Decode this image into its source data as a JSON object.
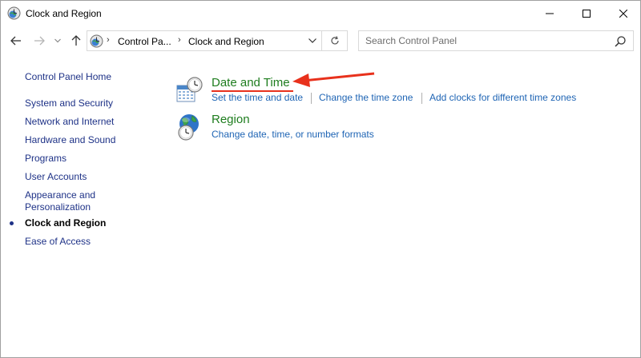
{
  "window": {
    "title": "Clock and Region",
    "title_icon": "clock-globe-icon"
  },
  "controls": {
    "minimize": "minimize-icon",
    "maximize": "maximize-icon",
    "close": "close-icon"
  },
  "nav": {
    "back": "arrow-left-icon",
    "forward": "arrow-right-icon",
    "recent": "chevron-down-icon",
    "up": "arrow-up-icon"
  },
  "address": {
    "breadcrumbs": [
      "Control Pa...",
      "Clock and Region"
    ],
    "separator": "›"
  },
  "search": {
    "placeholder": "Search Control Panel",
    "value": ""
  },
  "sidebar": {
    "home": "Control Panel Home",
    "items": [
      {
        "label": "System and Security",
        "current": false
      },
      {
        "label": "Network and Internet",
        "current": false
      },
      {
        "label": "Hardware and Sound",
        "current": false
      },
      {
        "label": "Programs",
        "current": false
      },
      {
        "label": "User Accounts",
        "current": false
      },
      {
        "label": "Appearance and",
        "label2": "Personalization",
        "current": false
      },
      {
        "label": "Clock and Region",
        "current": true
      },
      {
        "label": "Ease of Access",
        "current": false
      }
    ]
  },
  "categories": [
    {
      "title": "Date and Time",
      "icon": "calendar-clock-icon",
      "tasks": [
        "Set the time and date",
        "Change the time zone",
        "Add clocks for different time zones"
      ]
    },
    {
      "title": "Region",
      "icon": "globe-clock-icon",
      "tasks": [
        "Change date, time, or number formats"
      ]
    }
  ],
  "colors": {
    "annotation": "#e8311c",
    "category_title": "#1e7d1e",
    "task_link": "#1e64b4",
    "sidebar_link": "#1e3287"
  }
}
